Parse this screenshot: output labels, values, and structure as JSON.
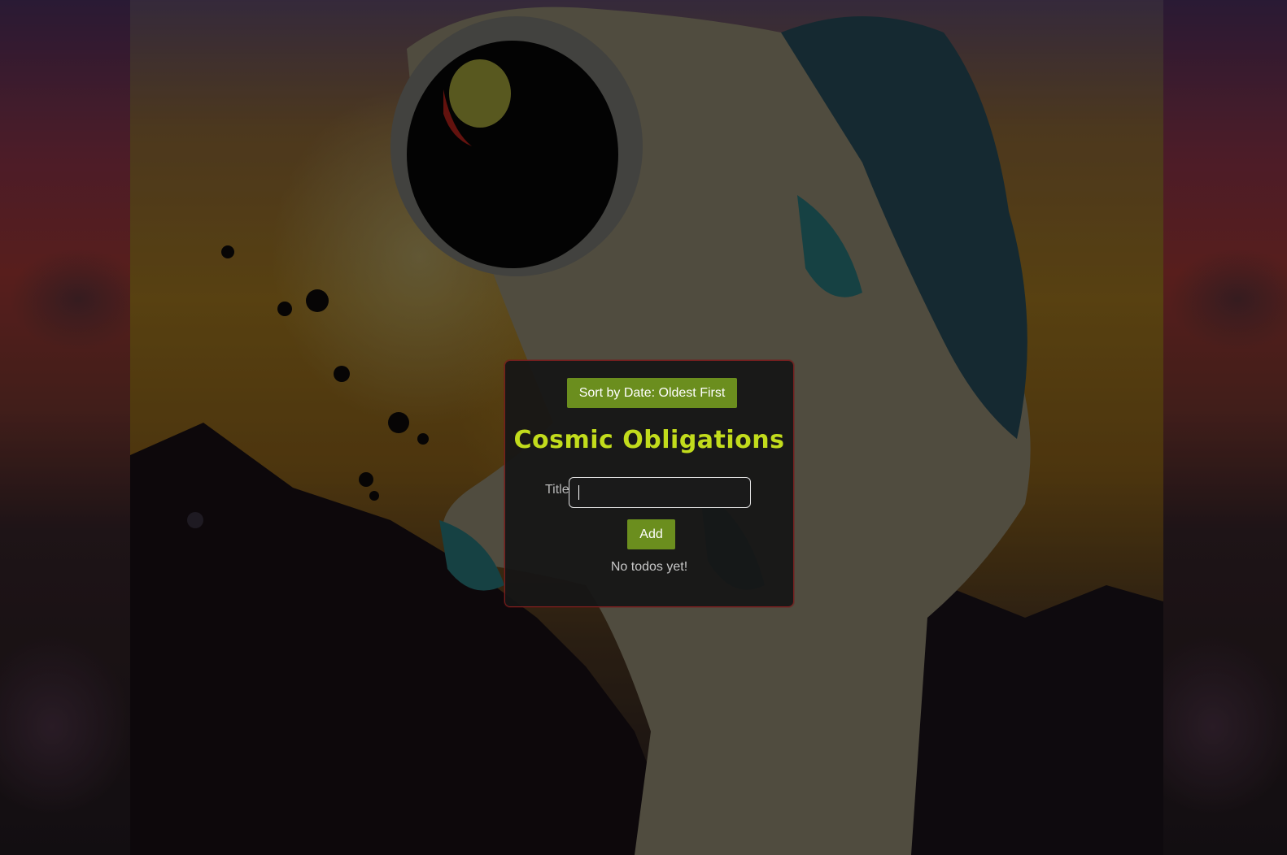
{
  "colors": {
    "accent_green": "#6b8e1e",
    "title_color": "#c2dc1c",
    "card_bg": "#161616",
    "card_border": "#7a1f1f"
  },
  "background": {
    "image": "astronaut-illustration"
  },
  "toolbar": {
    "sort_label": "Sort by Date: Oldest First"
  },
  "app": {
    "title": "Cosmic Obligations"
  },
  "form": {
    "title_label": "Title",
    "title_value": "",
    "add_label": "Add"
  },
  "todos": {
    "items": [],
    "empty_message": "No todos yet!"
  }
}
